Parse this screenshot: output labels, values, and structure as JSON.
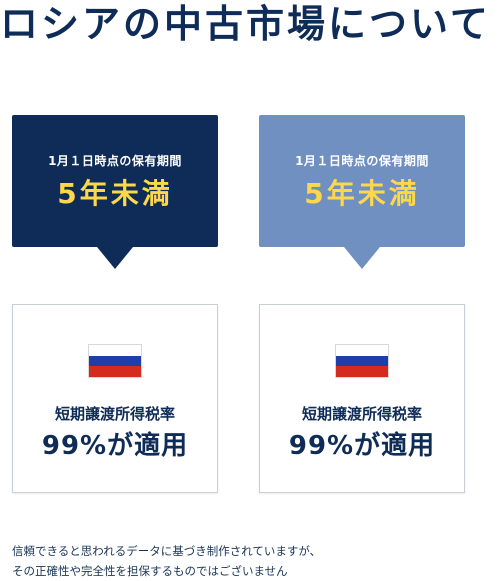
{
  "page_title": "ロシアの中古市場について",
  "columns": [
    {
      "condition": "1月１日時点の保有期間",
      "period": "5年未満",
      "tax_label": "短期譲渡所得税率",
      "tax_rate": "99%が適用"
    },
    {
      "condition": "1月１日時点の保有期間",
      "period": "5年未満",
      "tax_label": "短期譲渡所得税率",
      "tax_rate": "99%が適用"
    }
  ],
  "disclaimer": {
    "line1": "信頼できると思われるデータに基づき制作されていますが、",
    "line2": "その正確性や完全性を担保するものではございません"
  },
  "colors": {
    "dark_navy": "#0e2c57",
    "light_blue": "#6f90c0",
    "highlight_yellow": "#ffd84a"
  },
  "icons": [
    "russia-flag-icon"
  ]
}
